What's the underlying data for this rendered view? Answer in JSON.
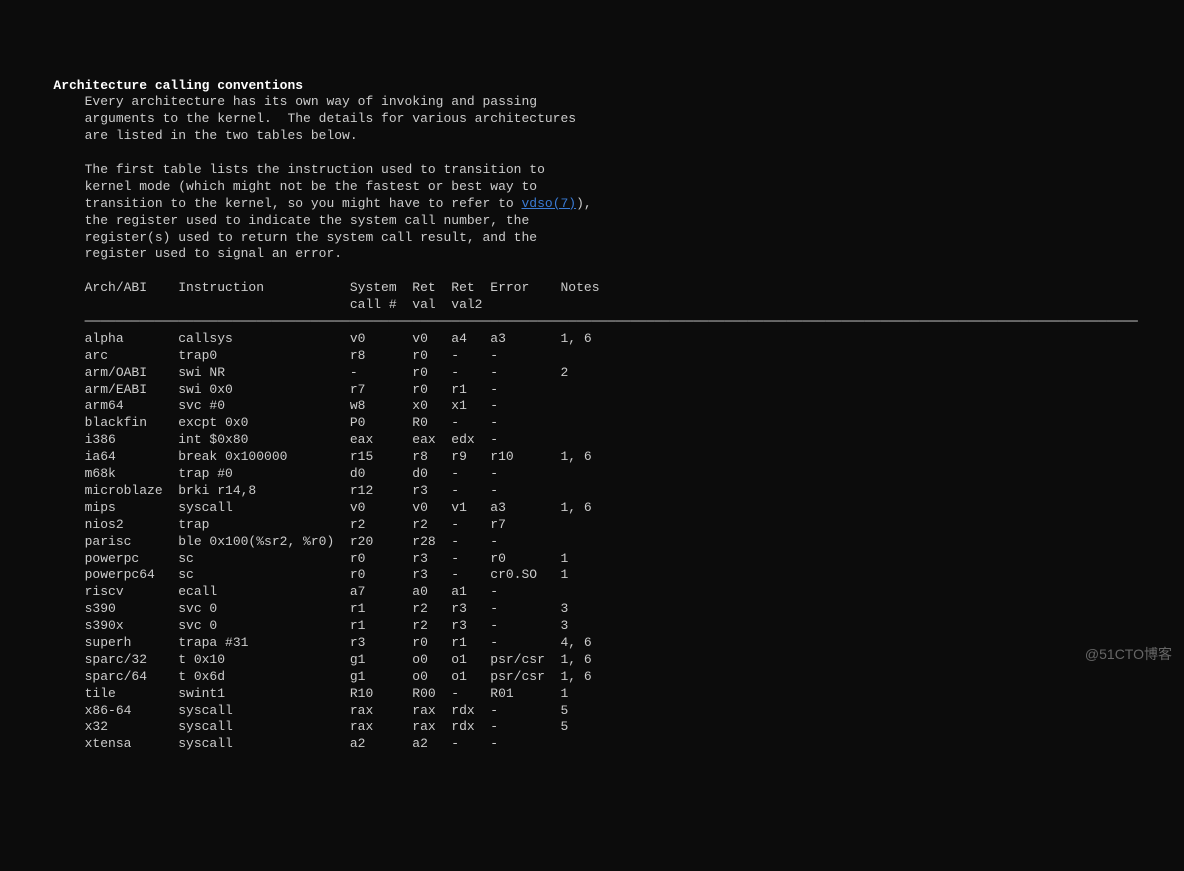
{
  "heading": "Architecture calling conventions",
  "para1": [
    "Every architecture has its own way of invoking and passing",
    "arguments to the kernel.  The details for various architectures",
    "are listed in the two tables below."
  ],
  "para2_before": [
    "The first table lists the instruction used to transition to",
    "kernel mode (which might not be the fastest or best way to",
    "transition to the kernel, so you might have to refer to "
  ],
  "link": "vdso(7)",
  "para2_after_link": "),",
  "para2_after": [
    "the register used to indicate the system call number, the",
    "register(s) used to return the system call result, and the",
    "register used to signal an error."
  ],
  "header1": "Arch/ABI    Instruction           System  Ret  Ret  Error    Notes",
  "header2": "                                  call #  val  val2",
  "hr": "───────────────────────────────────────────────────────────────────────────────────────────────────────────────────────────────────────",
  "rows": [
    "alpha       callsys               v0      v0   a4   a3       1, 6",
    "arc         trap0                 r8      r0   -    -",
    "arm/OABI    swi NR                -       r0   -    -        2",
    "arm/EABI    swi 0x0               r7      r0   r1   -",
    "arm64       svc #0                w8      x0   x1   -",
    "blackfin    excpt 0x0             P0      R0   -    -",
    "i386        int $0x80             eax     eax  edx  -",
    "ia64        break 0x100000        r15     r8   r9   r10      1, 6",
    "m68k        trap #0               d0      d0   -    -",
    "microblaze  brki r14,8            r12     r3   -    -",
    "mips        syscall               v0      v0   v1   a3       1, 6",
    "nios2       trap                  r2      r2   -    r7",
    "parisc      ble 0x100(%sr2, %r0)  r20     r28  -    -",
    "powerpc     sc                    r0      r3   -    r0       1",
    "powerpc64   sc                    r0      r3   -    cr0.SO   1",
    "riscv       ecall                 a7      a0   a1   -",
    "s390        svc 0                 r1      r2   r3   -        3",
    "s390x       svc 0                 r1      r2   r3   -        3",
    "superh      trapa #31             r3      r0   r1   -        4, 6",
    "sparc/32    t 0x10                g1      o0   o1   psr/csr  1, 6",
    "sparc/64    t 0x6d                g1      o0   o1   psr/csr  1, 6",
    "tile        swint1                R10     R00  -    R01      1",
    "x86-64      syscall               rax     rax  rdx  -        5",
    "x32         syscall               rax     rax  rdx  -        5",
    "xtensa      syscall               a2      a2   -    -"
  ],
  "watermark": "@51CTO博客"
}
